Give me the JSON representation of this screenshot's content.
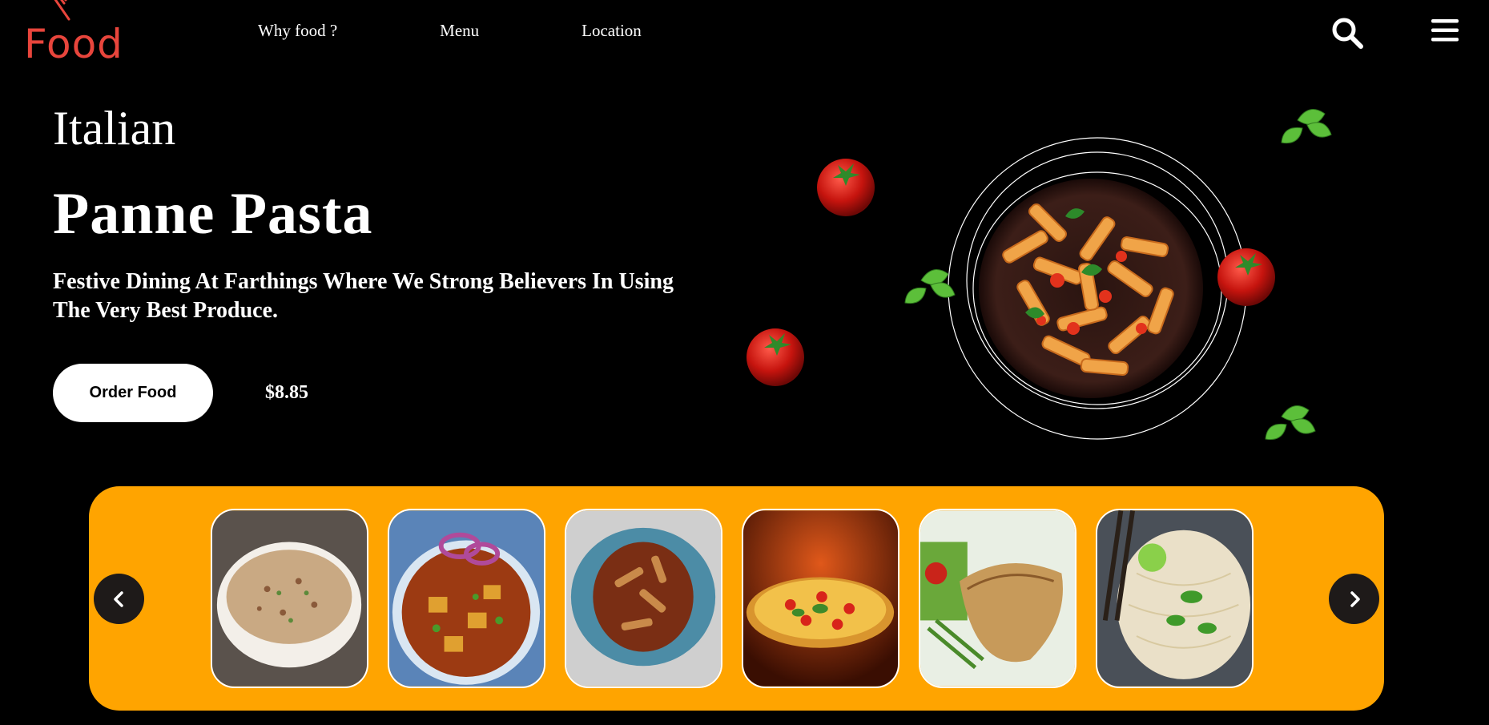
{
  "header": {
    "logo_text": "Food",
    "nav": [
      "Why food ?",
      "Menu",
      "Location"
    ],
    "search_icon": "search-icon",
    "menu_icon": "hamburger-menu-icon"
  },
  "hero": {
    "cuisine": "Italian",
    "dish_name": "Panne Pasta",
    "tagline": "Festive Dining At Farthings Where We Strong Believers In Using The Very Best Produce.",
    "order_button": "Order Food",
    "price": "$8.85"
  },
  "carousel": {
    "prev_icon": "chevron-left-icon",
    "next_icon": "chevron-right-icon",
    "items": [
      "fried-rice",
      "paneer-curry",
      "penne-bolognese",
      "pizza",
      "grilled-chicken",
      "noodle-salad"
    ]
  },
  "colors": {
    "background": "#000000",
    "brand": "#e8453c",
    "carousel_bg": "#ffa400",
    "arrow_bg": "#1e1a19"
  }
}
